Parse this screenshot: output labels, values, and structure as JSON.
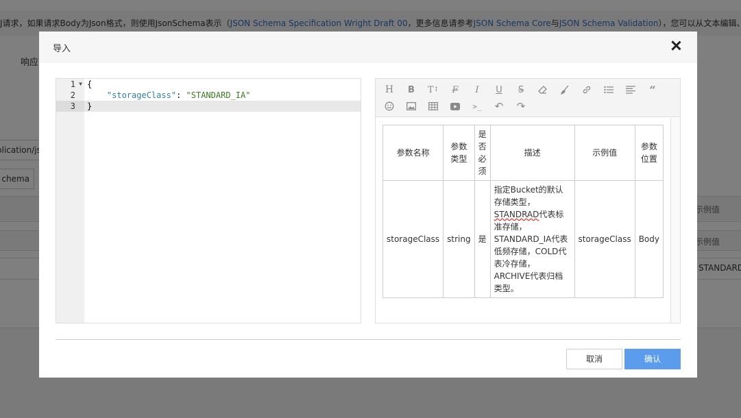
{
  "background": {
    "intro_prefix": "J请求，如果请求Body为Json格式，则使用JsonSchema表示（",
    "link1": "JSON Schema Specification Wright Draft 00",
    "intro_mid": "，更多信息请参考",
    "link2": "JSON Schema Core",
    "intro_and": "与",
    "link3": "JSON Schema Validation",
    "intro_suffix": "），您可以从文本编辑、导",
    "tab_label": "响应",
    "content_type": "plication/json",
    "schema_button": "chema",
    "col_example": "示例值",
    "row_example_placeholder": "示例值",
    "row_value": "STANDARD"
  },
  "modal": {
    "title": "导入",
    "close_icon": "close-icon",
    "cancel_label": "取消",
    "confirm_label": "确认",
    "accent_color": "#5b9cec"
  },
  "code_editor": {
    "line_numbers": [
      "1",
      "2",
      "3"
    ],
    "line1": "{",
    "line2_indent": "    ",
    "line2_key": "\"storageClass\"",
    "line2_colon": ": ",
    "line2_value": "\"STANDARD_IA\"",
    "line3": "}"
  },
  "rich_editor": {
    "toolbar_row1": [
      "heading-icon",
      "bold-icon",
      "font-size-icon",
      "strikethrough-f-icon",
      "italic-icon",
      "underline-icon",
      "strikethrough-icon",
      "eraser-icon",
      "brush-icon",
      "link-icon",
      "list-icon",
      "align-icon",
      "quote-icon"
    ],
    "toolbar_row2": [
      "emoji-icon",
      "image-icon",
      "table-icon",
      "video-icon",
      "code-icon",
      "undo-icon",
      "redo-icon"
    ],
    "table": {
      "headers": [
        "参数名称",
        "参数类型",
        "是否必须",
        "描述",
        "示例值",
        "参数位置"
      ],
      "row": {
        "name": "storageClass",
        "type": "string",
        "required": "是",
        "desc_part1": "指定Bucket的默认存储类型，",
        "desc_squiggle": "STANDRAD",
        "desc_part2": "代表标准存储，STANDARD_IA代表低频存储，COLD代表冷存储，ARCHIVE代表归档类型。",
        "example": "storageClass",
        "location": "Body"
      }
    }
  }
}
